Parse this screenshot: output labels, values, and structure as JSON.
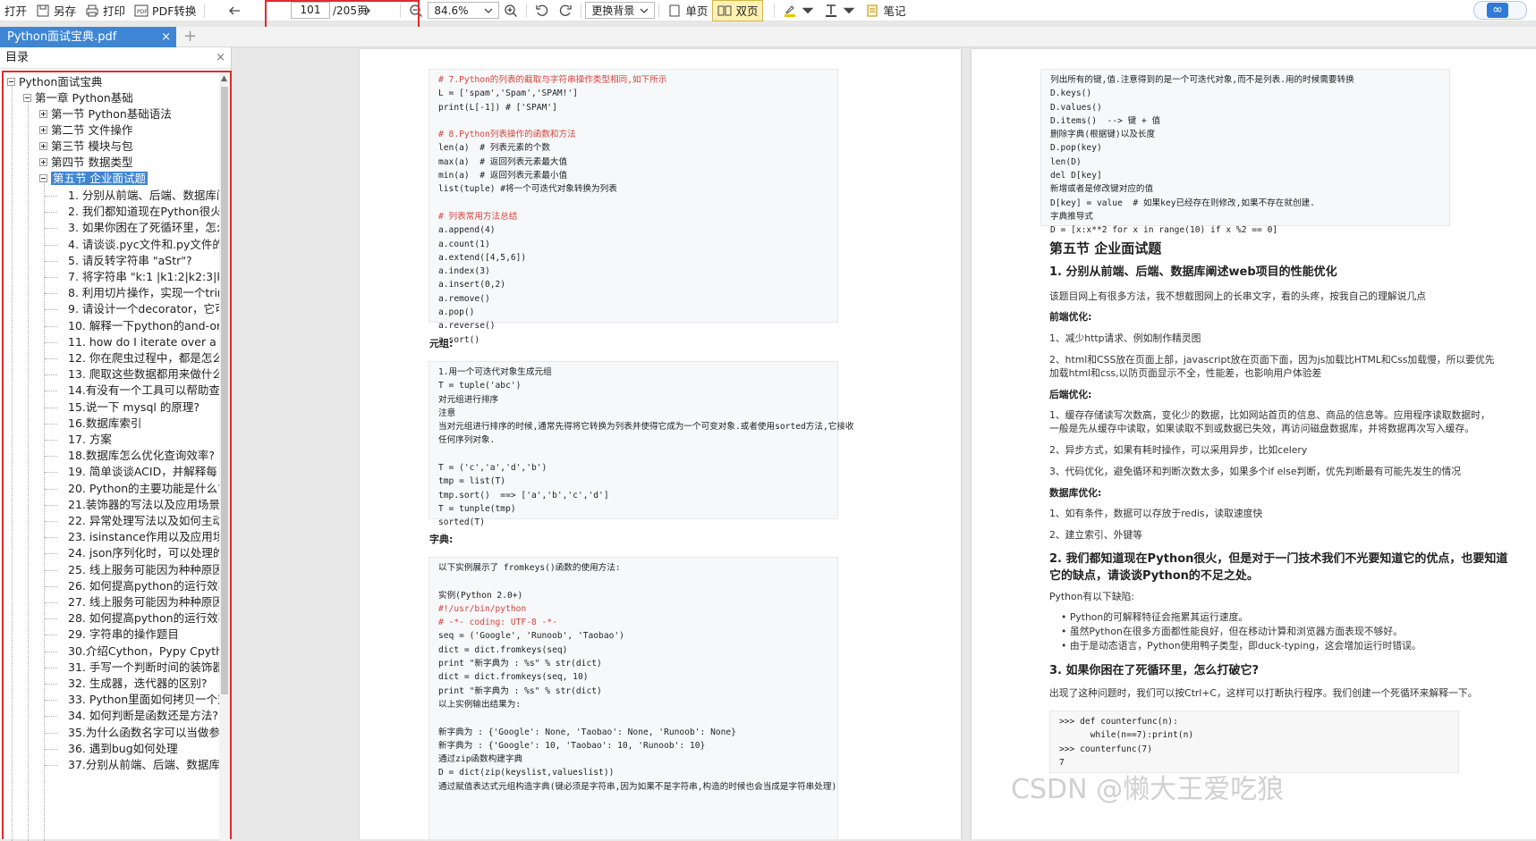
{
  "toolbar": {
    "open": "打开",
    "saveas": "另存",
    "print": "打印",
    "pdf_convert": "PDF转换",
    "page_current": "101",
    "page_total": "/205页",
    "zoom": "84.6%",
    "bg": "更换背景",
    "single": "单页",
    "double": "双页",
    "notes": "笔记"
  },
  "tab": {
    "title": "Python面试宝典.pdf",
    "close": "×",
    "new": "+"
  },
  "sidebar": {
    "title": "目录",
    "close": "×",
    "root": "Python面试宝典",
    "chapter": "第一章 Python基础",
    "sections": [
      "第一节 Python基础语法",
      "第二节 文件操作",
      "第三节 模块与包",
      "第四节 数据类型"
    ],
    "selected": "第五节 企业面试题",
    "items": [
      "1. 分别从前端、后端、数据库阐",
      "2. 我们都知道现在Python很火",
      "3. 如果你困在了死循环里，怎么",
      "4. 请谈谈.pyc文件和.py文件的",
      "5. 请反转字符串 \"aStr\"?",
      "7. 将字符串 \"k:1 |k1:2|k2:3|k3",
      "8. 利用切片操作，实现一个trim",
      "9. 请设计一个decorator，它可",
      "10. 解释一下python的and-or",
      "11. how do I iterate over a",
      "12. 你在爬虫过程中，都是怎么",
      "13. 爬取这些数据都用来做什么",
      "14.有没有一个工具可以帮助查",
      "15.说一下 mysql 的原理?",
      "16.数据库索引",
      "17. 方案",
      "18.数据库怎么优化查询效率?",
      "19. 简单谈谈ACID，并解释每",
      "20. Python的主要功能是什么?",
      "21.装饰器的写法以及应用场景",
      "22. 异常处理写法以及如何主动",
      "23. isinstance作用以及应用场",
      "24. json序列化时，可以处理的",
      "25. 线上服务可能因为种种原因",
      "26. 如何提高python的运行效率",
      "27. 线上服务可能因为种种原因",
      "28. 如何提高python的运行效率",
      "29. 字符串的操作题目",
      "30.介绍Cython，Pypy Cpytho",
      "31. 手写一个判断时间的装饰器",
      "32. 生成器，迭代器的区别?",
      "33. Python里面如何拷贝一个对",
      "34. 如何判断是函数还是方法?",
      "35.为什么函数名字可以当做参",
      "36. 遇到bug如何处理",
      "37.分别从前端、后端、数据库"
    ]
  },
  "page1": {
    "code1": [
      {
        "t": "# 7.Python的列表的截取与字符串操作类型相同,如下所示",
        "c": "red"
      },
      {
        "t": "L = ['spam','Spam','SPAM!']"
      },
      {
        "t": "print(L[-1]) # ['SPAM']"
      },
      {
        "t": ""
      },
      {
        "t": "# 8.Python列表操作的函数和方法",
        "c": "red"
      },
      {
        "t": "len(a)  # 列表元素的个数"
      },
      {
        "t": "max(a)  # 返回列表元素最大值"
      },
      {
        "t": "min(a)  # 返回列表元素最小值"
      },
      {
        "t": "list(tuple) #将一个可迭代对象转换为列表"
      },
      {
        "t": ""
      },
      {
        "t": "# 列表常用方法总结",
        "c": "red"
      },
      {
        "t": "a.append(4)"
      },
      {
        "t": "a.count(1)"
      },
      {
        "t": "a.extend([4,5,6])"
      },
      {
        "t": "a.index(3)"
      },
      {
        "t": "a.insert(0,2)"
      },
      {
        "t": "a.remove()"
      },
      {
        "t": "a.pop()"
      },
      {
        "t": "a.reverse()"
      },
      {
        "t": "a.sort()"
      }
    ],
    "label_tuple": "元组:",
    "code2": [
      {
        "t": "1.用一个可迭代对象生成元组"
      },
      {
        "t": "T = tuple('abc')"
      },
      {
        "t": "对元组进行排序"
      },
      {
        "t": "注意"
      },
      {
        "t": "当对元组进行排序的时候,通常先得将它转换为列表并使得它成为一个可变对象.或者使用sorted方法,它接收"
      },
      {
        "t": "任何序列对象."
      },
      {
        "t": ""
      },
      {
        "t": "T = ('c','a','d','b')"
      },
      {
        "t": "tmp = list(T)"
      },
      {
        "t": "tmp.sort()  ==> ['a','b','c','d']"
      },
      {
        "t": "T = tunple(tmp)"
      },
      {
        "t": "sorted(T)"
      }
    ],
    "label_dict": "字典:",
    "code3": [
      {
        "t": "以下实例展示了 fromkeys()函数的使用方法:"
      },
      {
        "t": ""
      },
      {
        "t": "实例(Python 2.0+)"
      },
      {
        "t": "#!/usr/bin/python",
        "c": "red"
      },
      {
        "t": "# -*- coding: UTF-8 -*-",
        "c": "red"
      },
      {
        "t": "seq = ('Google', 'Runoob', 'Taobao')"
      },
      {
        "t": "dict = dict.fromkeys(seq)"
      },
      {
        "t": "print \"新字典为 : %s\" % str(dict)"
      },
      {
        "t": "dict = dict.fromkeys(seq, 10)"
      },
      {
        "t": "print \"新字典为 : %s\" % str(dict)"
      },
      {
        "t": "以上实例输出结果为:"
      },
      {
        "t": ""
      },
      {
        "t": "新字典为 : {'Google': None, 'Taobao': None, 'Runoob': None}"
      },
      {
        "t": "新字典为 : {'Google': 10, 'Taobao': 10, 'Runoob': 10}"
      },
      {
        "t": "通过zip函数构建字典"
      },
      {
        "t": "D = dict(zip(keyslist,valueslist))"
      },
      {
        "t": "通过赋值表达式元组构造字典(键必须是字符串,因为如果不是字符串,构造的时候也会当成是字符串处理)"
      }
    ]
  },
  "page2": {
    "code_top": [
      {
        "t": "列出所有的键,值.注意得到的是一个可迭代对象,而不是列表.用的时候需要转换"
      },
      {
        "t": "D.keys()"
      },
      {
        "t": "D.values()"
      },
      {
        "t": "D.items()  --> 键 + 值"
      },
      {
        "t": "删除字典(根据键)以及长度"
      },
      {
        "t": "D.pop(key)"
      },
      {
        "t": "len(D)"
      },
      {
        "t": "del D[key]"
      },
      {
        "t": "新增或者是修改键对应的值"
      },
      {
        "t": "D[key] = value  # 如果key已经存在则修改,如果不存在就创建."
      },
      {
        "t": "字典推导式"
      },
      {
        "t": "D = [x:x**2 for x in range(10) if x %2 == 0]"
      }
    ],
    "h_section": "第五节 企业面试题",
    "h_q1": "1. 分别从前端、后端、数据库阐述web项目的性能优化",
    "p_intro": "该题目网上有很多方法，我不想截图网上的长串文字，看的头疼，按我自己的理解说几点",
    "frontend": "前端优化:",
    "fe1": "1、减少http请求、例如制作精灵图",
    "fe2a": "2、html和CSS放在页面上部，javascript放在页面下面，因为js加载比HTML和Css加载慢，所以要优先",
    "fe2b": "加载html和css,以防页面显示不全，性能差，也影响用户体验差",
    "backend": "后端优化:",
    "be1a": "1、缓存存储读写次数高，变化少的数据，比如网站首页的信息、商品的信息等。应用程序读取数据时，",
    "be1b": "一般是先从缓存中读取，如果读取不到或数据已失效，再访问磁盘数据库，并将数据再次写入缓存。",
    "be2": "2、异步方式，如果有耗时操作，可以采用异步，比如celery",
    "be3": "3、代码优化，避免循环和判断次数太多，如果多个if else判断，优先判断最有可能先发生的情况",
    "db": "数据库优化:",
    "db1": "1、如有条件，数据可以存放于redis，读取速度快",
    "db2": "2、建立索引、外键等",
    "h_q2": "2. 我们都知道现在Python很火，但是对于一门技术我们不光要知道它的优点，也要知道它的缺点，请谈谈Python的不足之处。",
    "p_q2": "Python有以下缺陷:",
    "li1": "Python的可解释特征会拖累其运行速度。",
    "li2": "虽然Python在很多方面都性能良好，但在移动计算和浏览器方面表现不够好。",
    "li3": "由于是动态语言，Python使用鸭子类型，即duck-typing，这会增加运行时错误。",
    "h_q3": "3. 如果你困在了死循环里，怎么打破它?",
    "p_q3": "出现了这种问题时，我们可以按Ctrl+C，这样可以打断执行程序。我们创建一个死循环来解释一下。",
    "code_bottom": [
      {
        "t": ">>> def counterfunc(n):"
      },
      {
        "t": "      while(n==7):print(n)"
      },
      {
        "t": ">>> counterfunc(7)"
      },
      {
        "t": "7"
      }
    ]
  },
  "watermark": "CSDN @懒大王爱吃狼",
  "colors": {
    "accent": "#3e86d4",
    "highlight_red": "#e12a2a",
    "code_red": "#d6443b"
  }
}
